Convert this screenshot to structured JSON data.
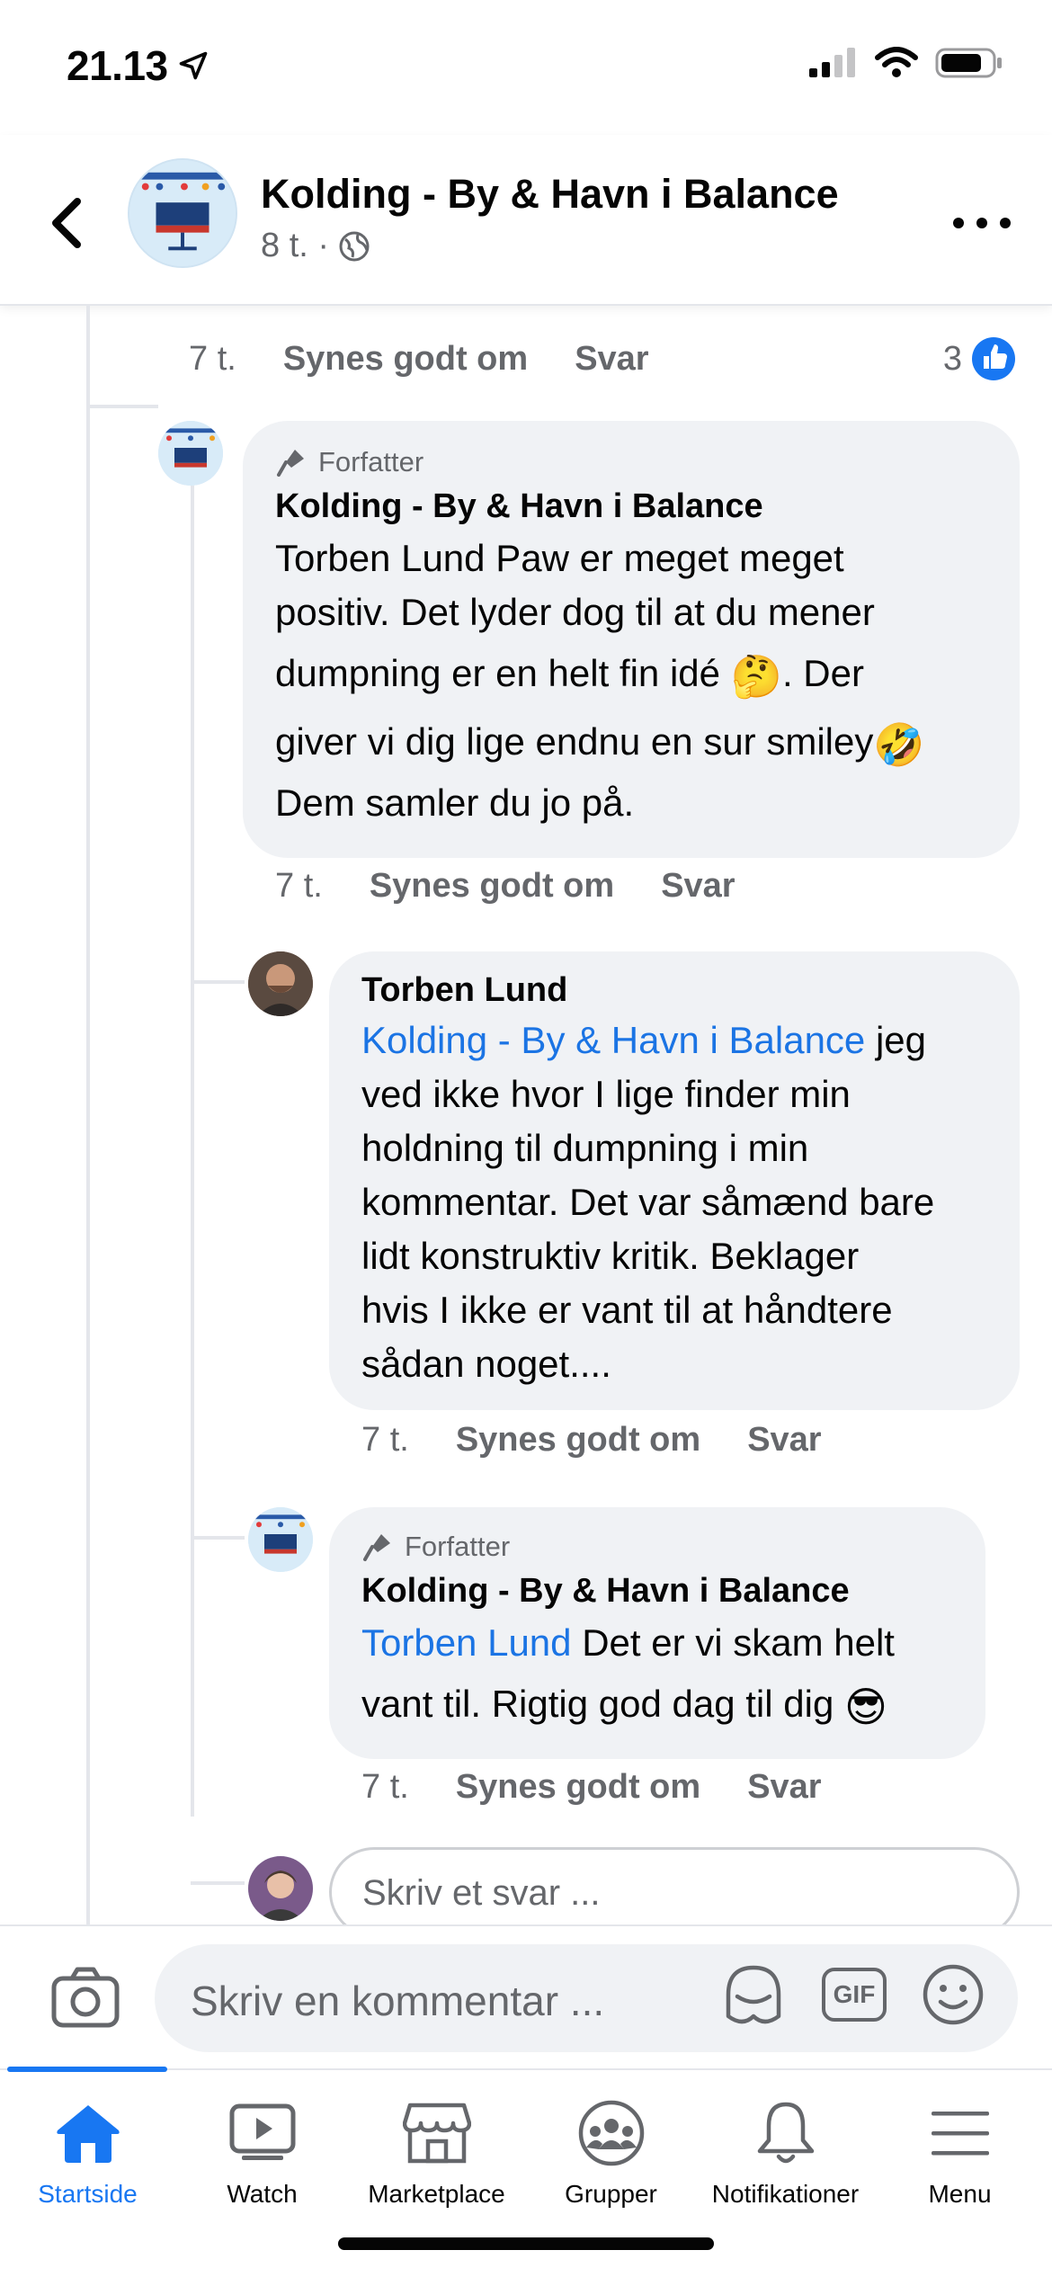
{
  "status_bar": {
    "time": "21.13"
  },
  "header": {
    "title": "Kolding - By & Havn i Balance",
    "meta": "8 t. ·"
  },
  "top_comment_actions": {
    "time": "7 t.",
    "like": "Synes godt om",
    "reply": "Svar",
    "reaction_count": "3"
  },
  "comments": [
    {
      "badge": "Forfatter",
      "name": "Kolding - By & Havn i Balance",
      "lines": [
        "Torben Lund Paw er meget meget",
        "positiv. Det lyder dog til at du mener",
        "dumpning er en helt fin idé",
        ". Der",
        "giver vi dig lige endnu en sur smiley",
        "Dem samler du jo på."
      ],
      "emoji_1": "🤔",
      "emoji_2": "🤣",
      "time": "7 t.",
      "like": "Synes godt om",
      "reply": "Svar"
    },
    {
      "name": "Torben Lund",
      "mention": "Kolding - By & Havn i Balance",
      "lines": [
        "jeg",
        "ved ikke hvor I lige finder min",
        "holdning til dumpning i min",
        "kommentar. Det var såmænd bare",
        "lidt konstruktiv kritik. Beklager",
        "hvis I ikke er vant til at håndtere",
        "sådan noget...."
      ],
      "time": "7 t.",
      "like": "Synes godt om",
      "reply": "Svar"
    },
    {
      "badge": "Forfatter",
      "name": "Kolding - By & Havn i Balance",
      "mention": "Torben Lund",
      "lines": [
        "Det er vi skam helt",
        "vant til. Rigtig god dag til dig"
      ],
      "emoji": "😎",
      "time": "7 t.",
      "like": "Synes godt om",
      "reply": "Svar"
    }
  ],
  "reply_input": {
    "placeholder": "Skriv et svar ..."
  },
  "composer": {
    "placeholder": "Skriv en kommentar ...",
    "gif_label": "GIF"
  },
  "tabs": [
    {
      "label": "Startside",
      "icon": "home-icon",
      "active": true
    },
    {
      "label": "Watch",
      "icon": "watch-icon"
    },
    {
      "label": "Marketplace",
      "icon": "marketplace-icon"
    },
    {
      "label": "Grupper",
      "icon": "groups-icon"
    },
    {
      "label": "Notifikationer",
      "icon": "bell-icon"
    },
    {
      "label": "Menu",
      "icon": "menu-icon"
    }
  ],
  "colors": {
    "accent": "#1877f2",
    "mention": "#1b74e4",
    "bubble": "#f0f2f5",
    "muted": "#65676b"
  }
}
